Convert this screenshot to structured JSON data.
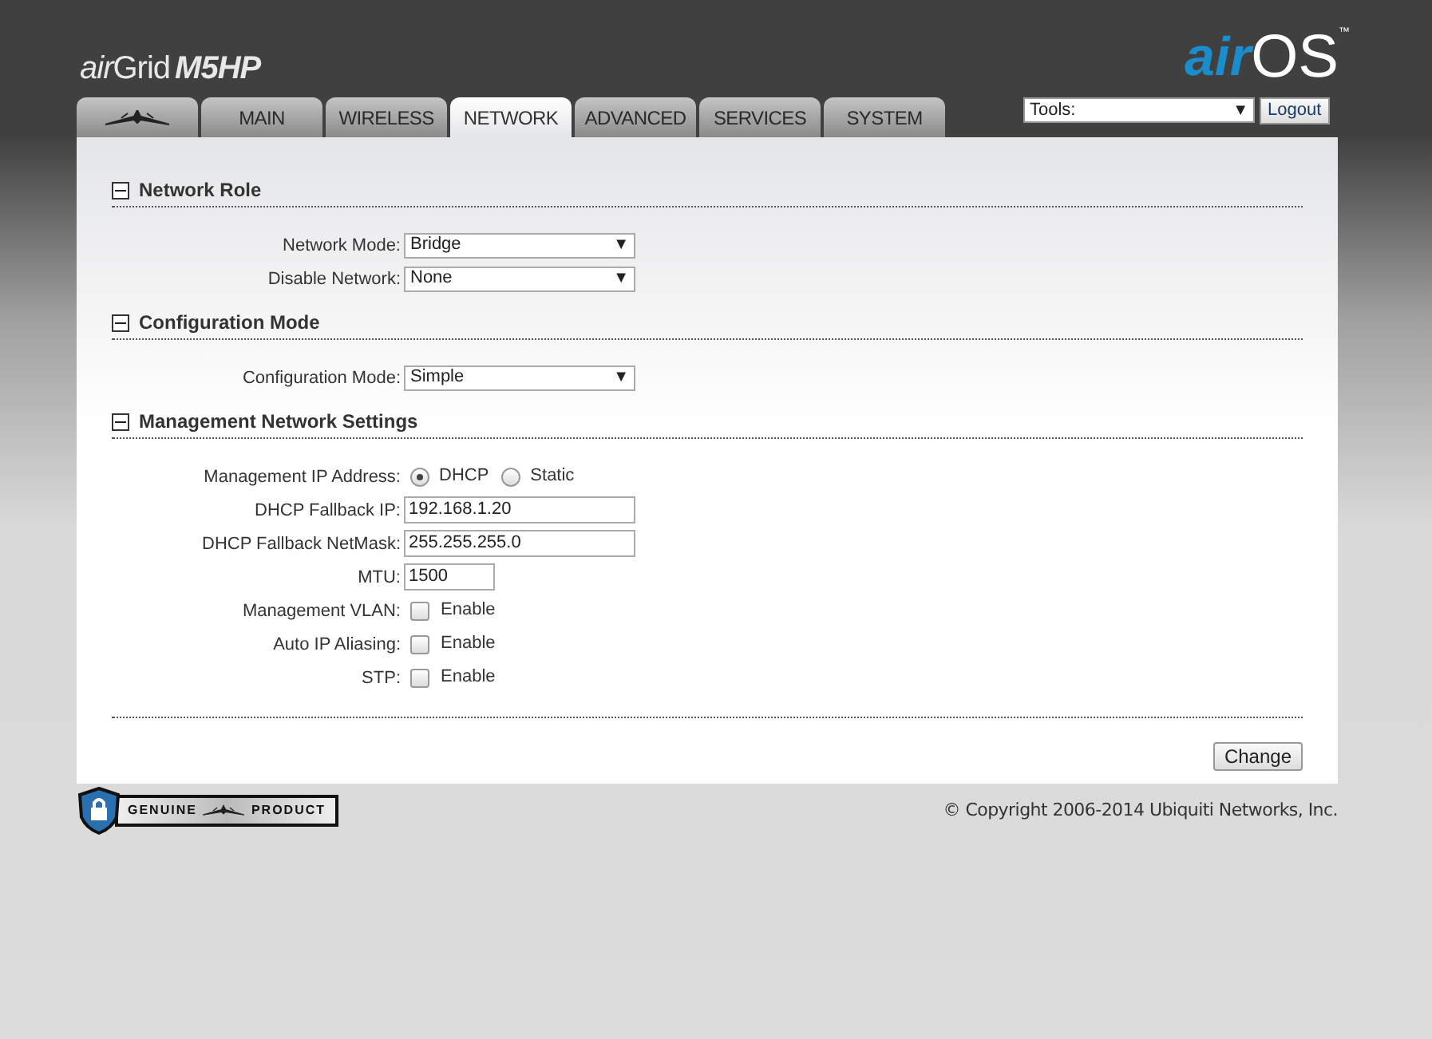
{
  "product_logo": {
    "air": "air",
    "grid": "Grid",
    "model": "M5HP"
  },
  "os_logo": {
    "air": "air",
    "os": "OS",
    "tm": "™"
  },
  "tabs": [
    {
      "kind": "icon",
      "selected": false
    },
    {
      "kind": "text",
      "label": "MAIN",
      "selected": false
    },
    {
      "kind": "text",
      "label": "WIRELESS",
      "selected": false
    },
    {
      "kind": "text",
      "label": "NETWORK",
      "selected": true
    },
    {
      "kind": "text",
      "label": "ADVANCED",
      "selected": false
    },
    {
      "kind": "text",
      "label": "SERVICES",
      "selected": false
    },
    {
      "kind": "text",
      "label": "SYSTEM",
      "selected": false
    }
  ],
  "tools": {
    "value": "Tools:",
    "arrow": "▼"
  },
  "logout_button": "Logout",
  "sections": [
    {
      "title": "Network Role",
      "expanded": true,
      "rows": [
        {
          "kind": "select",
          "label": "Network Mode:",
          "value": "Bridge",
          "arrow": "▼"
        },
        {
          "kind": "select",
          "label": "Disable Network:",
          "value": "None",
          "arrow": "▼"
        }
      ]
    },
    {
      "title": "Configuration Mode",
      "expanded": true,
      "rows": [
        {
          "kind": "select",
          "label": "Configuration Mode:",
          "value": "Simple",
          "arrow": "▼"
        }
      ]
    },
    {
      "title": "Management Network Settings",
      "expanded": true,
      "rows": [
        {
          "kind": "radio",
          "label": "Management IP Address:",
          "options": [
            {
              "label": "DHCP",
              "selected": true
            },
            {
              "label": "Static",
              "selected": false
            }
          ]
        },
        {
          "kind": "text",
          "label": "DHCP Fallback IP:",
          "value": "192.168.1.20"
        },
        {
          "kind": "text",
          "label": "DHCP Fallback NetMask:",
          "value": "255.255.255.0"
        },
        {
          "kind": "short_text",
          "label": "MTU:",
          "value": "1500"
        },
        {
          "kind": "checkbox",
          "label": "Management VLAN:",
          "option": "Enable",
          "checked": false
        },
        {
          "kind": "checkbox",
          "label": "Auto IP Aliasing:",
          "option": "Enable",
          "checked": false
        },
        {
          "kind": "checkbox",
          "label": "STP:",
          "option": "Enable",
          "checked": false
        }
      ]
    }
  ],
  "change_button": "Change",
  "badge": {
    "left": "GENUINE",
    "right": "PRODUCT"
  },
  "copyright": "© Copyright 2006-2014 Ubiquiti Networks, Inc."
}
